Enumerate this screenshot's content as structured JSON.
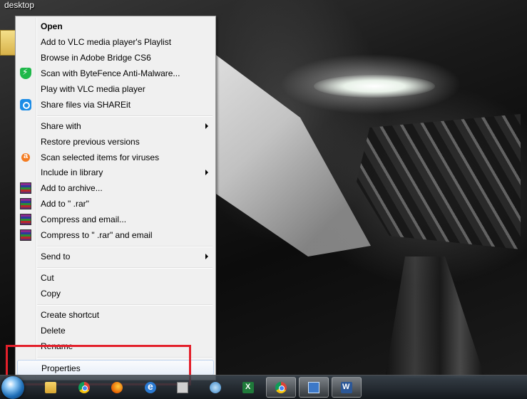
{
  "desktop": {
    "label": "desktop"
  },
  "context_menu": {
    "items": [
      {
        "label": "Open",
        "bold": true,
        "icon": null
      },
      {
        "label": "Add to VLC media player's Playlist",
        "icon": null
      },
      {
        "label": "Browse in Adobe Bridge CS6",
        "icon": null
      },
      {
        "label": "Scan with ByteFence Anti-Malware...",
        "icon": "bytefence-shield-icon"
      },
      {
        "label": "Play with VLC media player",
        "icon": null
      },
      {
        "label": "Share files via SHAREit",
        "icon": "shareit-icon"
      },
      {
        "label": "Share with",
        "submenu": true
      },
      {
        "label": "Restore previous versions"
      },
      {
        "label": "Scan selected items for viruses",
        "icon": "avast-icon"
      },
      {
        "label": "Include in library",
        "submenu": true
      },
      {
        "label": "Add to archive...",
        "icon": "winrar-icon"
      },
      {
        "label": "Add to \" .rar\"",
        "icon": "winrar-icon"
      },
      {
        "label": "Compress and email...",
        "icon": "winrar-icon"
      },
      {
        "label": "Compress to \" .rar\" and email",
        "icon": "winrar-icon"
      },
      {
        "label": "Send to",
        "submenu": true
      },
      {
        "label": "Cut"
      },
      {
        "label": "Copy"
      },
      {
        "label": "Create shortcut"
      },
      {
        "label": "Delete"
      },
      {
        "label": "Rename"
      },
      {
        "label": "Properties",
        "hovered": true
      }
    ]
  },
  "annotation": {
    "color": "#e3202b"
  },
  "taskbar": {
    "icons": [
      "folder-icon",
      "chrome-icon",
      "firefox-icon",
      "internet-explorer-icon",
      "printer-icon",
      "app-circle-icon",
      "excel-icon",
      "chrome-icon",
      "remote-desktop-icon",
      "word-icon"
    ]
  }
}
